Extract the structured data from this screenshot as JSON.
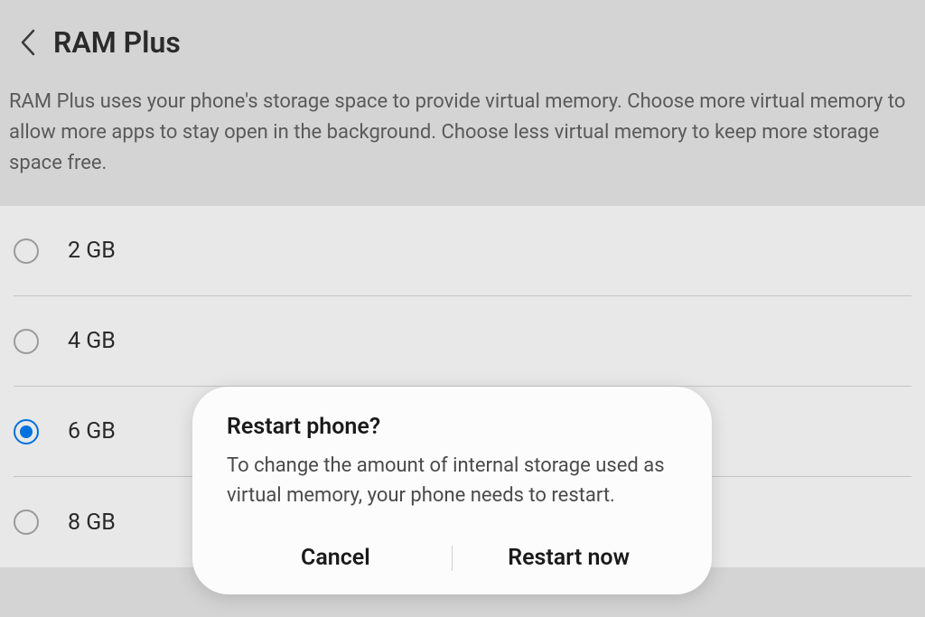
{
  "header": {
    "title": "RAM Plus"
  },
  "description": "RAM Plus uses your phone's storage space to provide virtual memory. Choose more virtual memory to allow more apps to stay open in the background. Choose less virtual memory to keep more storage space free.",
  "options": [
    {
      "label": "2 GB",
      "selected": false
    },
    {
      "label": "4 GB",
      "selected": false
    },
    {
      "label": "6 GB",
      "selected": true
    },
    {
      "label": "8 GB",
      "selected": false
    }
  ],
  "dialog": {
    "title": "Restart phone?",
    "body": "To change the amount of internal storage used as virtual memory, your phone needs to restart.",
    "cancel_label": "Cancel",
    "confirm_label": "Restart now"
  }
}
